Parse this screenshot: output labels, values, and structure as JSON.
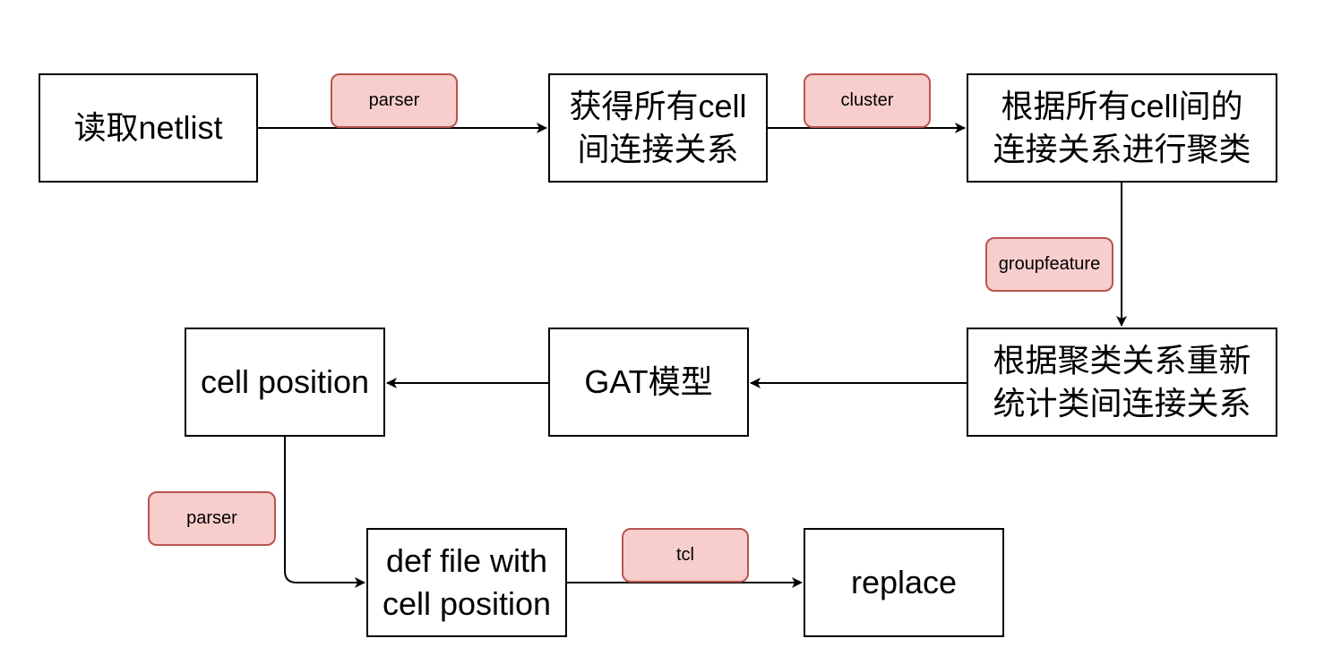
{
  "nodes": {
    "read_netlist": {
      "lines": [
        "读取netlist"
      ]
    },
    "get_connections": {
      "lines": [
        "获得所有cell",
        "间连接关系"
      ]
    },
    "cluster_by_connections": {
      "lines": [
        "根据所有cell间的",
        "连接关系进行聚类"
      ]
    },
    "recount_connections": {
      "lines": [
        "根据聚类关系重新",
        "统计类间连接关系"
      ]
    },
    "gat_model": {
      "lines": [
        "GAT模型"
      ]
    },
    "cell_position": {
      "lines": [
        "cell position"
      ]
    },
    "def_file": {
      "lines": [
        "def file with",
        "cell position"
      ]
    },
    "replace": {
      "lines": [
        "replace"
      ]
    }
  },
  "edge_labels": {
    "parser1": "parser",
    "cluster": "cluster",
    "groupfeature": "groupfeature",
    "parser2": "parser",
    "tcl": "tcl"
  },
  "colors": {
    "label_fill": "#f8cecc",
    "label_stroke": "#b85450",
    "line": "#000000"
  }
}
